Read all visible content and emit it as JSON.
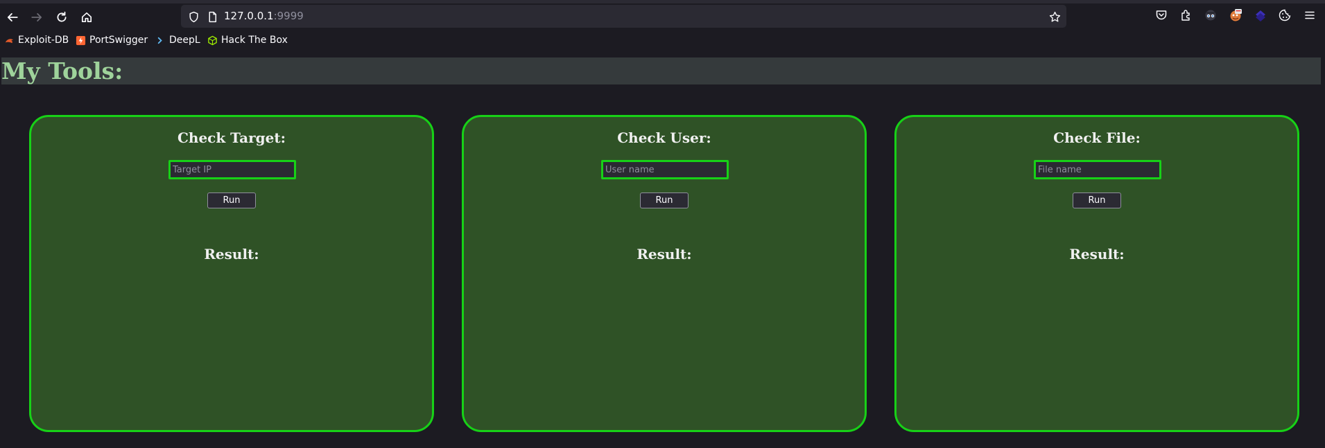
{
  "browser": {
    "url_host": "127.0.0.1",
    "url_port": ":9999",
    "bookmarks": [
      {
        "label": "Exploit-DB",
        "icon": "exploit-db-icon"
      },
      {
        "label": "PortSwigger",
        "icon": "portswigger-icon"
      },
      {
        "label": "DeepL",
        "icon": "deepl-icon"
      },
      {
        "label": "Hack The Box",
        "icon": "hackthebox-icon"
      }
    ]
  },
  "page": {
    "title": "My Tools:",
    "cards": [
      {
        "heading": "Check Target:",
        "placeholder": "Target IP",
        "button": "Run",
        "result_label": "Result:"
      },
      {
        "heading": "Check User:",
        "placeholder": "User name",
        "button": "Run",
        "result_label": "Result:"
      },
      {
        "heading": "Check File:",
        "placeholder": "File name",
        "button": "Run",
        "result_label": "Result:"
      }
    ]
  },
  "colors": {
    "page_background": "#1c1b22",
    "title_background": "#353a3c",
    "title_text": "#9fd39b",
    "card_background": "#2f5226",
    "card_border": "#17d117"
  }
}
